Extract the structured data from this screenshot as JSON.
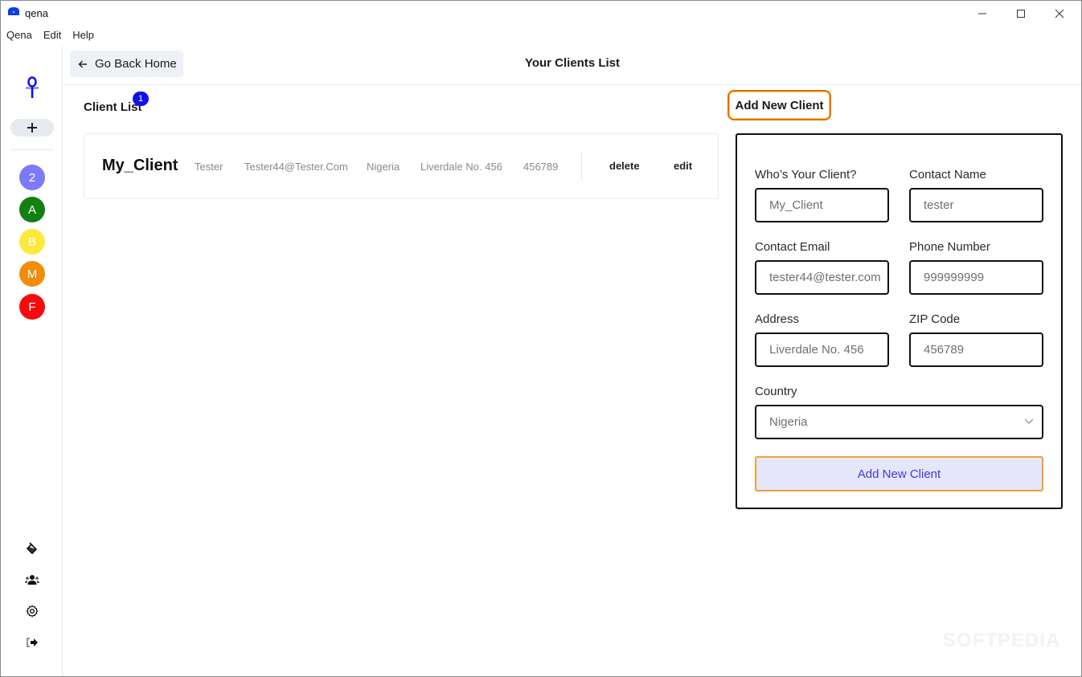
{
  "window": {
    "title": "qena",
    "controls": {
      "minimize": "minimize",
      "maximize": "maximize",
      "close": "close"
    }
  },
  "menu": [
    "Qena",
    "Edit",
    "Help"
  ],
  "sidebar": {
    "logo_icon": "ankh-logo-icon",
    "add_icon": "plus-icon",
    "workspaces": [
      {
        "label": "2",
        "color": "#7b7bfa"
      },
      {
        "label": "A",
        "color": "#128012"
      },
      {
        "label": "B",
        "color": "#fde93c"
      },
      {
        "label": "M",
        "color": "#f28c0c"
      },
      {
        "label": "F",
        "color": "#f40c0c"
      }
    ],
    "bottom_icons": [
      "paint-bucket-icon",
      "users-icon",
      "gear-icon",
      "sign-out-icon"
    ]
  },
  "header": {
    "back_label": "Go Back Home",
    "title": "Your Clients List"
  },
  "client_list": {
    "title": "Client List",
    "count": "1",
    "clients": [
      {
        "name": "My_Client",
        "contact": "Tester",
        "email": "Tester44@Tester.Com",
        "country": "Nigeria",
        "address": "Liverdale No. 456",
        "zip": "456789",
        "delete_label": "delete",
        "edit_label": "edit"
      }
    ]
  },
  "form": {
    "title": "Add New Client",
    "fields": {
      "client": {
        "label": "Who’s Your Client?",
        "value": "My_Client"
      },
      "contact_name": {
        "label": "Contact Name",
        "value": "tester"
      },
      "email": {
        "label": "Contact Email",
        "value": "tester44@tester.com"
      },
      "phone": {
        "label": "Phone Number",
        "value": "999999999"
      },
      "address": {
        "label": "Address",
        "value": "Liverdale No. 456"
      },
      "zip": {
        "label": "ZIP Code",
        "value": "456789"
      },
      "country": {
        "label": "Country",
        "value": "Nigeria"
      }
    },
    "submit_label": "Add New Client"
  },
  "watermark": "SOFTPEDIA"
}
